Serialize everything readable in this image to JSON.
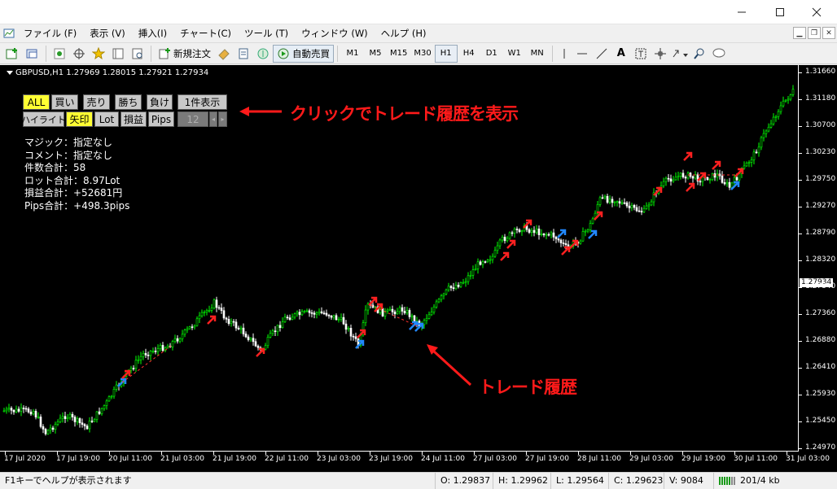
{
  "window": {
    "minimize_icon": "minimize-icon",
    "maximize_icon": "maximize-icon",
    "close_icon": "close-icon"
  },
  "menu": {
    "items": [
      "ファイル (F)",
      "表示 (V)",
      "挿入(I)",
      "チャート(C)",
      "ツール (T)",
      "ウィンドウ (W)",
      "ヘルプ (H)"
    ]
  },
  "toolbar": {
    "new_order_label": "新規注文",
    "auto_trade_label": "自動売買",
    "timeframes": [
      "M1",
      "M5",
      "M15",
      "M30",
      "H1",
      "H4",
      "D1",
      "W1",
      "MN"
    ],
    "active_timeframe": "H1",
    "text_tool": "A"
  },
  "chart": {
    "info": "GBPUSD,H1  1.27969 1.28015 1.27921 1.27934",
    "current_price": "1.27934",
    "price_ticks": [
      "1.31660",
      "1.31180",
      "1.30700",
      "1.30230",
      "1.29750",
      "1.29270",
      "1.28790",
      "1.28320",
      "1.27840",
      "1.27360",
      "1.26880",
      "1.26410",
      "1.25930",
      "1.25450",
      "1.24970"
    ],
    "time_ticks": [
      "17 Jul 2020",
      "17 Jul 19:00",
      "20 Jul 11:00",
      "21 Jul 03:00",
      "21 Jul 19:00",
      "22 Jul 11:00",
      "23 Jul 03:00",
      "23 Jul 19:00",
      "24 Jul 11:00",
      "27 Jul 03:00",
      "27 Jul 19:00",
      "28 Jul 11:00",
      "29 Jul 03:00",
      "29 Jul 19:00",
      "30 Jul 11:00",
      "31 Jul 03:00"
    ],
    "bull_color": "#00ff00",
    "bear_color": "#ffffff"
  },
  "panel": {
    "row1": [
      "ALL",
      "買い",
      "売り",
      "勝ち",
      "負け",
      "1件表示"
    ],
    "row2": [
      "ハイライト",
      "矢印",
      "Lot",
      "損益",
      "Pips"
    ],
    "counter": "12",
    "prev_icon": "arrow-left-icon",
    "next_icon": "arrow-right-icon",
    "highlight_color": "#ffff33"
  },
  "stats": {
    "magic": "マジック：指定なし",
    "comment": "コメント：指定なし",
    "count": "件数合計：58",
    "lot": "ロット合計：8.97Lot",
    "profit": "損益合計：+52681円",
    "pips": "Pips合計：+498.3pips"
  },
  "annotations": {
    "click_note": "クリックでトレード履歴を表示",
    "trade_history": "トレード履歴",
    "color": "#ff1a1a"
  },
  "status": {
    "help": "F1キーでヘルプが表示されます",
    "open": "O: 1.29837",
    "high": "H: 1.29962",
    "low": "L: 1.29564",
    "close": "C: 1.29623",
    "volume": "V: 9084",
    "traffic": "201/4 kb"
  }
}
